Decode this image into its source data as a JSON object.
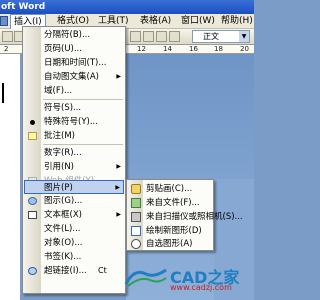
{
  "title": "oft Word",
  "menubar": {
    "items": [
      "插入(I)",
      "格式(O)",
      "工具(T)",
      "表格(A)",
      "窗口(W)",
      "帮助(H)"
    ],
    "active": "插入(I)"
  },
  "toolbar": {
    "style_value": "正文"
  },
  "ruler": {
    "numbers": [
      "2",
      "4",
      "6",
      "8",
      "10",
      "12",
      "14",
      "16",
      "18",
      "20"
    ]
  },
  "insert_menu": {
    "items": [
      {
        "label": "分隔符(B)...",
        "icon": "none"
      },
      {
        "label": "页码(U)...",
        "icon": "none"
      },
      {
        "label": "日期和时间(T)...",
        "icon": "none"
      },
      {
        "label": "自动图文集(A)",
        "icon": "none",
        "submenu": true
      },
      {
        "label": "域(F)...",
        "icon": "none"
      },
      {
        "label": "符号(S)...",
        "icon": "none"
      },
      {
        "label": "特殊符号(Y)...",
        "icon": "bullet-icon"
      },
      {
        "label": "批注(M)",
        "icon": "comment-icon"
      },
      {
        "label": "数字(R)...",
        "icon": "none"
      },
      {
        "label": "引用(N)",
        "icon": "none",
        "submenu": true
      },
      {
        "label": "Web 组件(Y)...",
        "icon": "web-component-icon",
        "disabled": true
      },
      {
        "label": "图片(P)",
        "icon": "none",
        "submenu": true,
        "highlighted": true
      },
      {
        "label": "图示(G)...",
        "icon": "diagram-icon"
      },
      {
        "label": "文本框(X)",
        "icon": "textbox-icon",
        "submenu": true
      },
      {
        "label": "文件(L)...",
        "icon": "none"
      },
      {
        "label": "对象(O)...",
        "icon": "none"
      },
      {
        "label": "书签(K)...",
        "icon": "none"
      },
      {
        "label": "超链接(I)...",
        "icon": "hyperlink-icon",
        "shortcut": "Ct"
      }
    ]
  },
  "picture_submenu": {
    "items": [
      {
        "label": "剪贴画(C)...",
        "icon": "clipart-icon"
      },
      {
        "label": "来自文件(F)...",
        "icon": "from-file-icon"
      },
      {
        "label": "来自扫描仪或照相机(S)...",
        "icon": "scanner-icon"
      },
      {
        "label": "绘制新图形(D)",
        "icon": "new-drawing-icon"
      },
      {
        "label": "自选图形(A)",
        "icon": "autoshape-icon"
      }
    ]
  },
  "watermark": {
    "brand": "CAD之家",
    "url": "www.cadzj.com"
  },
  "colors": {
    "highlight": "#c1d2ee",
    "highlight_border": "#316ac5",
    "titlebar": "#1b4fc0"
  }
}
